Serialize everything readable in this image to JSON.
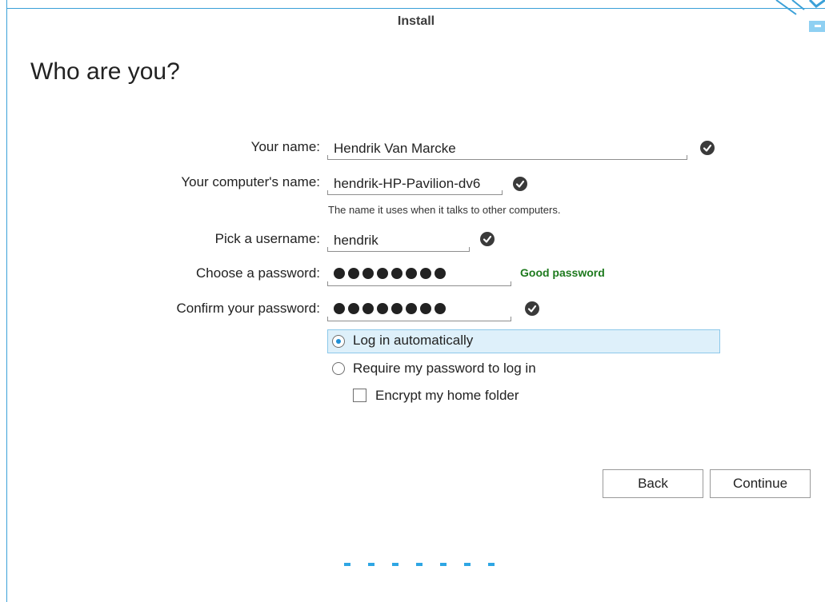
{
  "window": {
    "title": "Install"
  },
  "page": {
    "heading": "Who are you?"
  },
  "form": {
    "name": {
      "label": "Your name:",
      "value": "Hendrik Van Marcke",
      "valid": true
    },
    "computer": {
      "label": "Your computer's name:",
      "value": "hendrik-HP-Pavilion-dv6",
      "valid": true,
      "hint": "The name it uses when it talks to other computers."
    },
    "username": {
      "label": "Pick a username:",
      "value": "hendrik",
      "valid": true
    },
    "password": {
      "label": "Choose a password:",
      "masked_length": 8,
      "strength": "Good password"
    },
    "confirm": {
      "label": "Confirm your password:",
      "masked_length": 8,
      "valid": true
    }
  },
  "login_options": {
    "auto": {
      "label": "Log in automatically",
      "selected": true
    },
    "require": {
      "label": "Require my password to log in",
      "selected": false
    },
    "encrypt": {
      "label": "Encrypt my home folder",
      "checked": false
    }
  },
  "buttons": {
    "back": "Back",
    "continue": "Continue"
  },
  "progress": {
    "steps": 7
  },
  "colors": {
    "accent": "#2ea6e4",
    "frame": "#3aa0d8",
    "good_password": "#1e7a1e",
    "selected_row": "#def0fa"
  },
  "icons": {
    "valid": "check-circle-icon",
    "corner": "window-corner-decoration"
  }
}
